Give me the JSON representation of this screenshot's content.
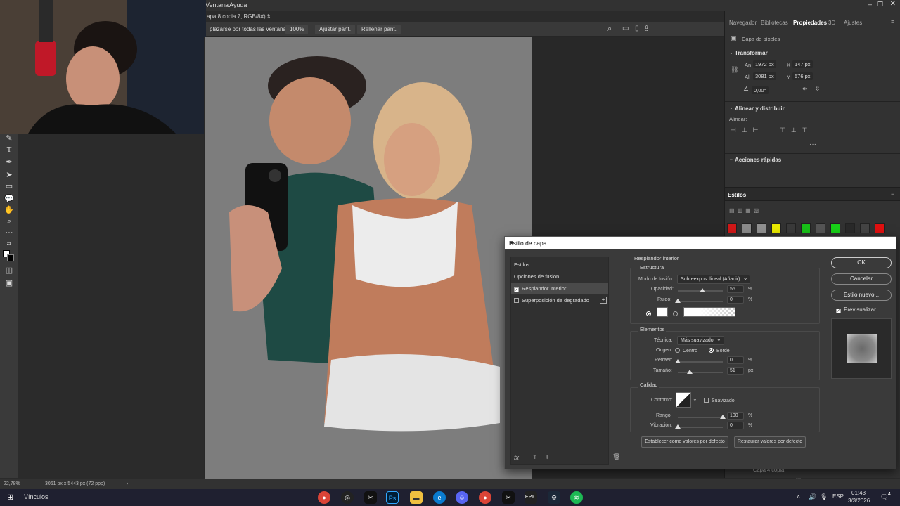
{
  "menubar": {
    "items": [
      "Ventana",
      "Ayuda"
    ]
  },
  "document": {
    "tab_title": "apa 8 copia 7, RGB/8#) *",
    "close": "×"
  },
  "options": {
    "scroll_all": "plazarse por todas las ventanas",
    "zoom_100": "100%",
    "fit": "Ajustar pant.",
    "fill": "Rellenar pant."
  },
  "right_panel": {
    "tabs": [
      "Navegador",
      "Bibliotecas",
      "Propiedades",
      "3D",
      "Ajustes"
    ],
    "active_tab": "Propiedades",
    "layer_type": "Capa de píxeles",
    "transform": {
      "title": "Transformar",
      "w_label": "An",
      "w": "1972 px",
      "h_label": "Al",
      "h": "3081 px",
      "x_label": "X",
      "x": "147 px",
      "y_label": "Y",
      "y": "576 px",
      "angle": "0,00°"
    },
    "align": {
      "title": "Alinear y distribuir",
      "label": "Alinear:"
    },
    "quick": {
      "title": "Acciones rápidas"
    },
    "styles_tab": "Estilos",
    "layer_bottom": "Capa 4 copia"
  },
  "style_colors": [
    "#d01818",
    "#8a8a8a",
    "#909090",
    "#e8e800",
    "#3a3a3a",
    "#18c018",
    "#555555",
    "#18d018",
    "#2a2a2a",
    "#444444",
    "#e01010"
  ],
  "dialog": {
    "title": "Estilo de capa",
    "left_items": [
      {
        "label": "Estilos",
        "checkbox": null
      },
      {
        "label": "Opciones de fusión",
        "checkbox": null
      },
      {
        "label": "Resplandor interior",
        "checkbox": "on"
      },
      {
        "label": "Superposición de degradado",
        "checkbox": "off"
      }
    ],
    "panel_title": "Resplandor interior",
    "structure": {
      "title": "Estructura",
      "blend_label": "Modo de fusión:",
      "blend_value": "Sobreexpos. lineal (Añadir)",
      "opacity_label": "Opacidad:",
      "opacity_value": "55",
      "opacity_pct": 0.55,
      "noise_label": "Ruido:",
      "noise_value": "0",
      "noise_pct": 0.0
    },
    "elements": {
      "title": "Elementos",
      "technique_label": "Técnica:",
      "technique_value": "Más suavizado",
      "source_label": "Origen:",
      "center": "Centro",
      "edge": "Borde",
      "choke_label": "Retraer:",
      "choke_value": "0",
      "choke_pct": 0.0,
      "size_label": "Tamaño:",
      "size_value": "51",
      "size_unit": "px",
      "size_pct": 0.26
    },
    "quality": {
      "title": "Calidad",
      "contour_label": "Contorno:",
      "antialias": "Suavizado",
      "range_label": "Rango:",
      "range_value": "100",
      "range_pct": 1.0,
      "jitter_label": "Vibración:",
      "jitter_value": "0",
      "jitter_pct": 0.0
    },
    "pct": "%",
    "set_default": "Establecer como valores por defecto",
    "reset_default": "Restaurar valores por defecto",
    "ok": "OK",
    "cancel": "Cancelar",
    "new_style": "Estilo nuevo...",
    "preview": "Previsualizar",
    "fx": "fx"
  },
  "status": {
    "zoom": "22,78%",
    "size": "3061 px x 5443 px (72 ppp)"
  },
  "taskbar": {
    "left_label": "Vínculos",
    "lang": "ESP",
    "time": "01:43",
    "date": "3/3/2026",
    "notif": "4"
  }
}
